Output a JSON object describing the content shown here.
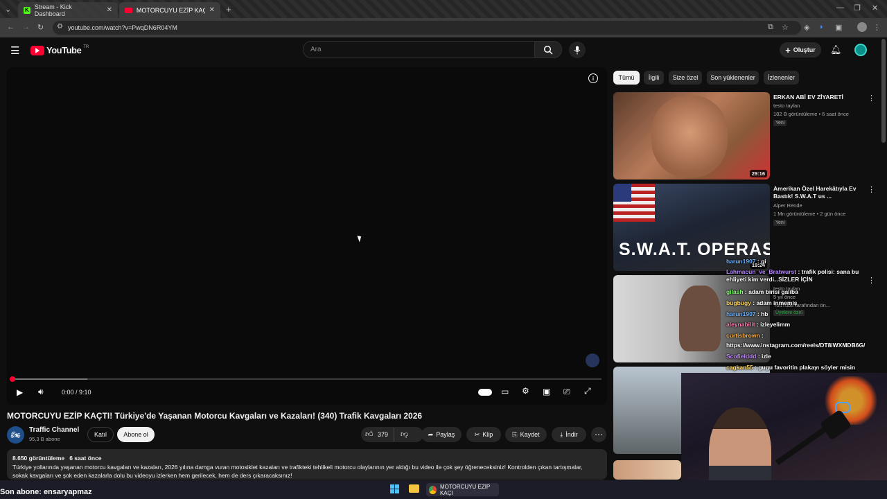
{
  "browser": {
    "tabs": [
      {
        "label": "Stream - Kick Dashboard"
      },
      {
        "label": "MOTORCUYU EZİP KAÇTI! Türki"
      }
    ],
    "url": "youtube.com/watch?v=PwqDN6R04YM"
  },
  "youtube": {
    "logo": "YouTube",
    "region": "TR",
    "search_placeholder": "Ara",
    "create_label": "Oluştur"
  },
  "player": {
    "time": "0:00 / 9:10",
    "progress": 0.0
  },
  "video": {
    "title": "MOTORCUYU EZİP KAÇTI! Türkiye'de Yaşanan Motorcu Kavgaları ve Kazaları! (340) Trafik Kavgaları 2026",
    "channel": "Traffic Channel",
    "subscribers": "95,3 B abone",
    "join_label": "Katıl",
    "subscribe_label": "Abone ol",
    "likes": "379",
    "share_label": "Paylaş",
    "clip_label": "Klip",
    "save_label": "Kaydet",
    "download_label": "İndir",
    "views": "8.650 görüntüleme",
    "published": "6 saat önce",
    "description_line1": "Türkiye yollarında yaşanan motorcu kavgaları ve kazaları, 2026 yılına damga vuran motosiklet kazaları ve trafikteki tehlikeli motorcu olaylarının yer aldığı bu video ile çok şey öğreneceksiniz! Kontrolden çıkan tartışmalar,",
    "description_line2": "sokak kavgaları ve şok eden kazalarla dolu bu videoyu izlerken hem gerilecek, hem de ders çıkaracaksınız!"
  },
  "chips": [
    {
      "label": "Tümü"
    },
    {
      "label": "İlgili"
    },
    {
      "label": "Size özel"
    },
    {
      "label": "Son yüklenenler"
    },
    {
      "label": "İzlenenler"
    }
  ],
  "recommendations": [
    {
      "title": "ERKAN ABİ EV ZİYARETİ",
      "channel": "testo taylan",
      "meta": "182 B görüntüleme • 6 saat önce",
      "badge": "Yeni",
      "duration": "29:16"
    },
    {
      "title": "Amerikan Özel Harekâtıyla Ev Bastık! S.W.A.T us ...",
      "channel": "Alper Rende",
      "meta": "1 Mn görüntüleme • 2 gün önce",
      "badge": "Yeni",
      "duration": "19:24",
      "thumb_text": "S.W.A.T. OPERASYON"
    },
    {
      "title": "...SİZLER İÇİN",
      "channel": "testo taylan",
      "meta": "5 yıl önce",
      "extra": "YouTube tarafından ön...",
      "badge": "Üyelere özel"
    }
  ],
  "chat": [
    {
      "user": "harun1907",
      "msg": "gi",
      "color": "#6fb3ff"
    },
    {
      "user": "Lahmacun_ve_Bratwurst",
      "msg": "trafik polisi: sana bu ehliyeti kim verdi",
      "color": "#b887ff"
    },
    {
      "user": "gilash",
      "msg": "adam birisi galiba",
      "color": "#7fff6a"
    },
    {
      "user": "bugbugy",
      "msg": "adam inmemiş",
      "color": "#ffd85a"
    },
    {
      "user": "harun1907",
      "msg": "hb",
      "color": "#6fb3ff"
    },
    {
      "user": "aleynabilit",
      "msg": "izleyelimm",
      "color": "#ff7ab0"
    },
    {
      "user": "curtisbrown",
      "msg": "",
      "color": "#ffb347"
    },
    {
      "user": "",
      "msg": "https://www.instagram.com/reels/DT8iWXMDB6G/",
      "color": "#ffffff"
    },
    {
      "user": "Scofielddd",
      "msg": "izle",
      "color": "#c48cff"
    },
    {
      "user": "cagkan55",
      "msg": "gugu favoritin plakayı söyler misin",
      "color": "#ffd85a"
    }
  ],
  "overlay": {
    "last_sub": "Son abone: ensaryapmaz"
  },
  "taskbar": {
    "chrome_label": "MOTORCUYU EZİP KAÇI"
  }
}
